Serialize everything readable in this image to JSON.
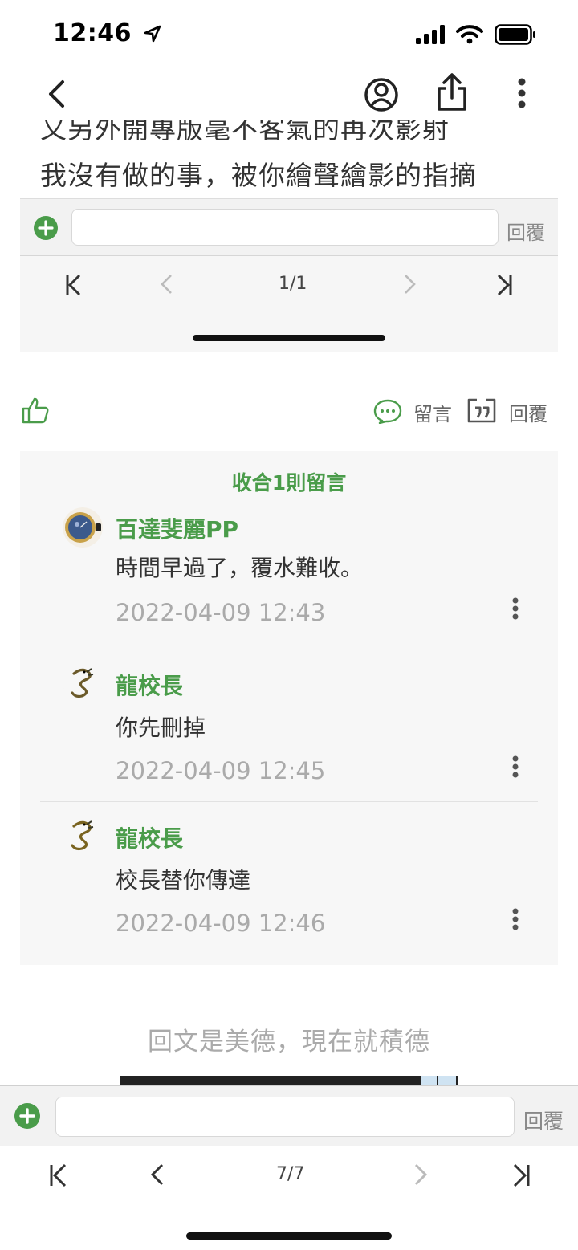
{
  "status": {
    "time": "12:46"
  },
  "post": {
    "line1": "又另外開專版毫不客氣的再次影射",
    "line2": "我沒有做的事，被你繪聲繪影的指摘"
  },
  "embedded": {
    "reply_placeholder": "",
    "reply_label": "回覆",
    "page_indicator": "1/1"
  },
  "actions": {
    "comment_label": "留言",
    "quote_label": "回覆"
  },
  "comments": {
    "collapse_label": "收合1則留言",
    "items": [
      {
        "author": "百達斐麗PP",
        "text": "時間早過了，覆水難收。",
        "time": "2022-04-09 12:43"
      },
      {
        "author": "龍校長",
        "text": "你先刪掉",
        "time": "2022-04-09 12:45"
      },
      {
        "author": "龍校長",
        "text": "校長替你傳達",
        "time": "2022-04-09 12:46"
      }
    ]
  },
  "promo_text": "回文是美德，現在就積德",
  "bottom": {
    "reply_placeholder": "",
    "reply_label": "回覆",
    "page_indicator": "7/7"
  },
  "colors": {
    "accent_green": "#4a9c4a",
    "text_gray": "#aaaaaa",
    "bar_gray": "#f2f2f2"
  }
}
